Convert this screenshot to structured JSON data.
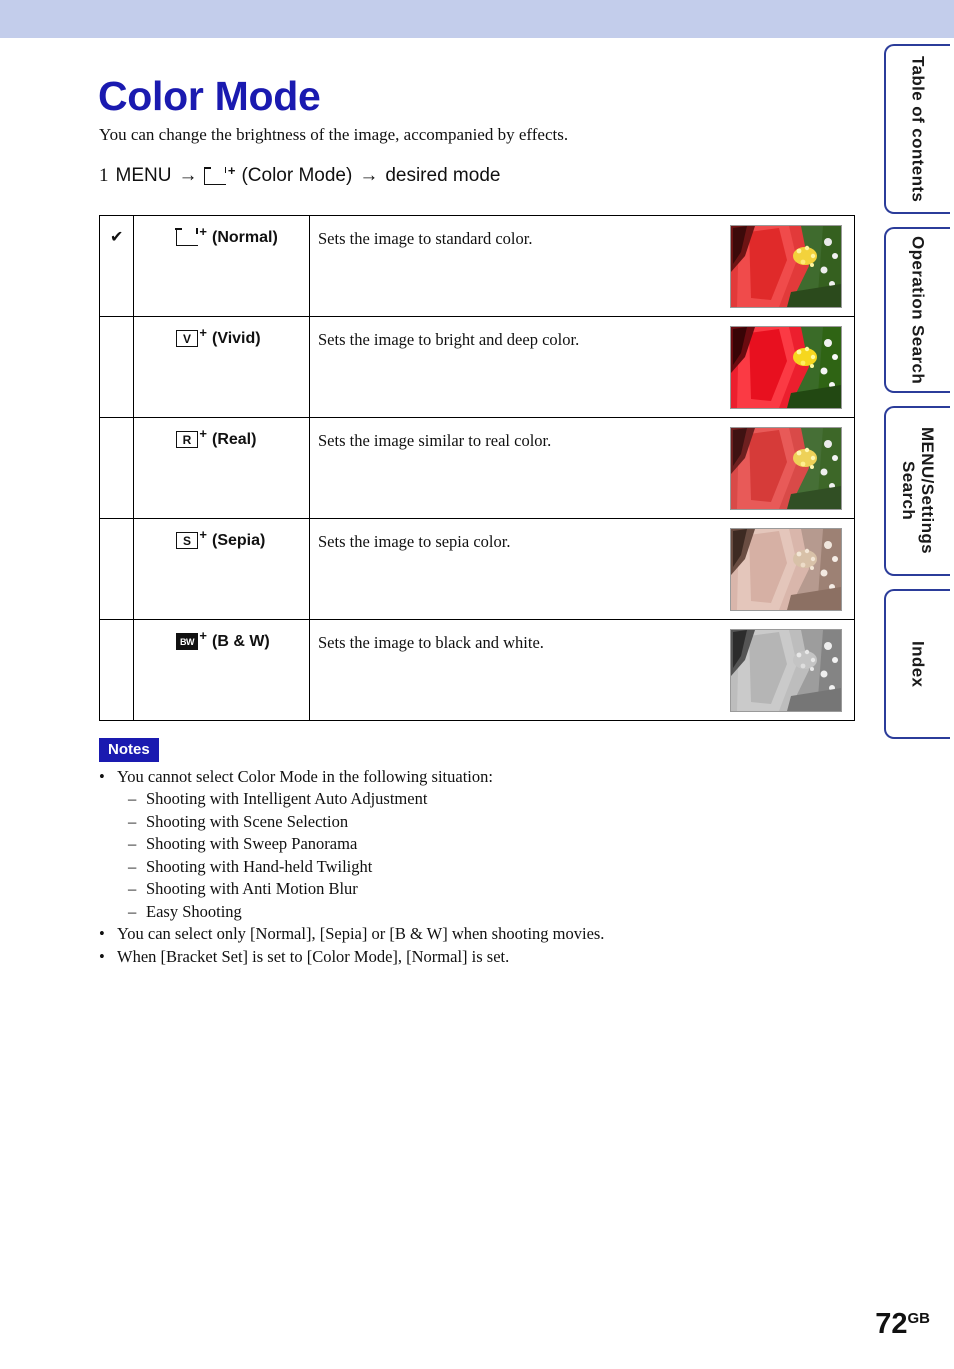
{
  "page": {
    "title": "Color Mode",
    "intro": "You can change the brightness of the image, accompanied by effects.",
    "page_number": "72",
    "page_suffix": "GB"
  },
  "step": {
    "number": "1",
    "menu_label": "MENU",
    "arrow1": "→",
    "icon_label": "(Color Mode)",
    "arrow2": "→",
    "target": "desired mode"
  },
  "table": {
    "rows": [
      {
        "check": "✔",
        "icon": "normal-icon",
        "name": "(Normal)",
        "description": "Sets the image to standard color.",
        "thumbnail": "red-flower-normal"
      },
      {
        "check": "",
        "icon": "vivid-icon",
        "name": "(Vivid)",
        "description": "Sets the image to bright and deep color.",
        "thumbnail": "red-flower-vivid"
      },
      {
        "check": "",
        "icon": "real-icon",
        "name": "(Real)",
        "description": "Sets the image similar to real color.",
        "thumbnail": "red-flower-real"
      },
      {
        "check": "",
        "icon": "sepia-icon",
        "name": "(Sepia)",
        "description": "Sets the image to sepia color.",
        "thumbnail": "flower-sepia"
      },
      {
        "check": "",
        "icon": "bw-icon",
        "name": "(B & W)",
        "description": "Sets the image to black and white.",
        "thumbnail": "flower-black-and-white"
      }
    ]
  },
  "notes": {
    "badge": "Notes",
    "items": [
      "You cannot select Color Mode in the following situation:",
      "You can select only [Normal], [Sepia] or [B & W] when shooting movies.",
      "When [Bracket Set] is set to [Color Mode], [Normal] is set."
    ],
    "sub_items": [
      "Shooting with Intelligent Auto Adjustment",
      "Shooting with Scene Selection",
      "Shooting with Sweep Panorama",
      "Shooting with Hand-held Twilight",
      "Shooting with Anti Motion Blur",
      "Easy Shooting"
    ]
  },
  "side_tabs": [
    {
      "label": "Table of contents"
    },
    {
      "label": "Operation Search"
    },
    {
      "label": "MENU/Settings Search"
    },
    {
      "label": "Index"
    }
  ],
  "colors": {
    "band": "#c3cdeb",
    "heading": "#1a1ab0",
    "tab_border": "#2b3c9a"
  }
}
